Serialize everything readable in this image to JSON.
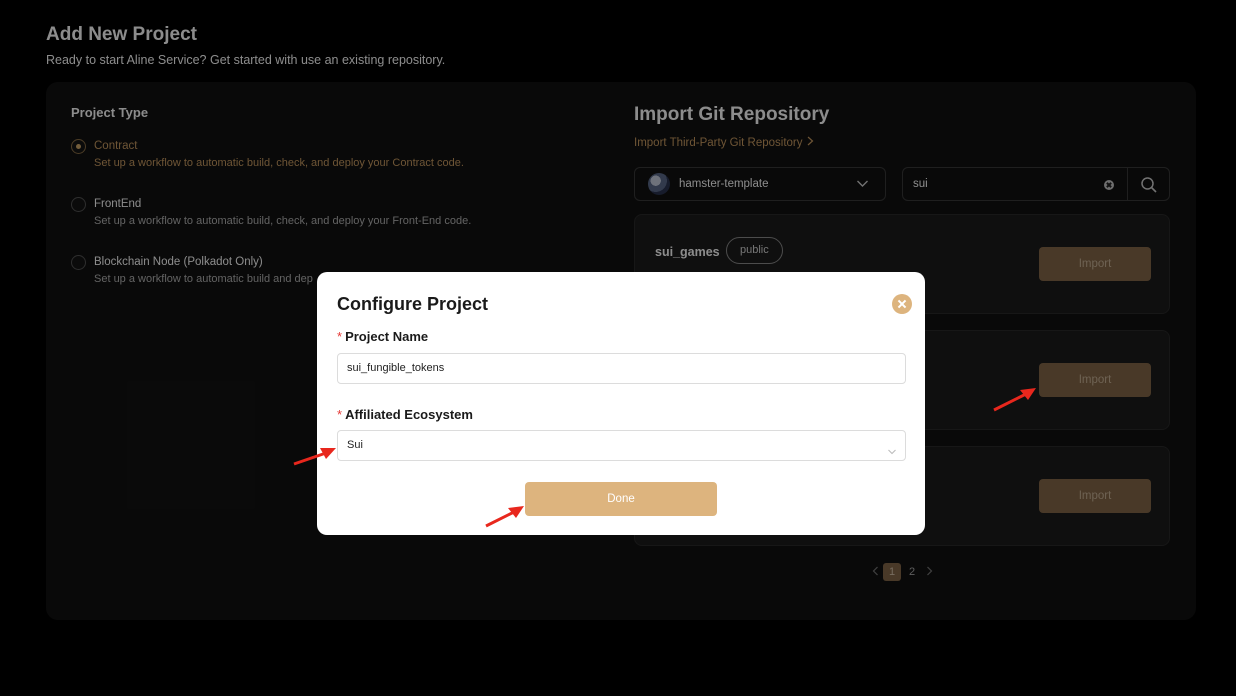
{
  "page": {
    "title": "Add New Project",
    "subtitle": "Ready to start Aline Service? Get started with use an existing repository."
  },
  "project_type": {
    "title": "Project Type",
    "options": [
      {
        "label": "Contract",
        "desc": "Set up a workflow to automatic build, check, and deploy your Contract code.",
        "selected": true
      },
      {
        "label": "FrontEnd",
        "desc": "Set up a workflow to automatic build, check, and deploy your Front-End code.",
        "selected": false
      },
      {
        "label": "Blockchain Node (Polkadot Only)",
        "desc": "Set up a workflow to automatic build and dep",
        "selected": false
      }
    ]
  },
  "import": {
    "title": "Import Git Repository",
    "third_party_link": "Import Third-Party Git Repository",
    "repo_owner": "hamster-template",
    "search_value": "sui",
    "repos": [
      {
        "name": "sui_games",
        "badge": "public",
        "button": "Import"
      },
      {
        "name": "",
        "badge": "",
        "button": "Import"
      },
      {
        "name": "",
        "badge": "",
        "button": "Import"
      }
    ],
    "pagination": {
      "pages": [
        "1",
        "2"
      ],
      "current": "1"
    }
  },
  "modal": {
    "title": "Configure Project",
    "required_mark": "*",
    "project_name_label": "Project Name",
    "project_name_value": "sui_fungible_tokens",
    "ecosystem_label": "Affiliated Ecosystem",
    "ecosystem_value": "Sui",
    "done_button": "Done"
  },
  "colors": {
    "accent": "#ddb47e",
    "accent_dark": "#86694a",
    "link": "#c99b62",
    "annotation_arrow": "#e8271d"
  }
}
